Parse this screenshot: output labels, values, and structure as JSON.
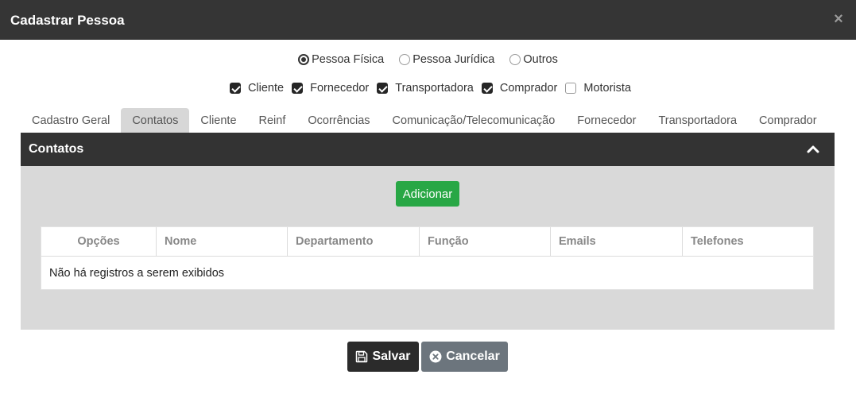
{
  "header": {
    "title": "Cadastrar Pessoa",
    "close_label": "×"
  },
  "person_type": {
    "options": [
      {
        "label": "Pessoa Física",
        "checked": true
      },
      {
        "label": "Pessoa Jurídica",
        "checked": false
      },
      {
        "label": "Outros",
        "checked": false
      }
    ]
  },
  "roles": {
    "options": [
      {
        "label": "Cliente",
        "checked": true
      },
      {
        "label": "Fornecedor",
        "checked": true
      },
      {
        "label": "Transportadora",
        "checked": true
      },
      {
        "label": "Comprador",
        "checked": true
      },
      {
        "label": "Motorista",
        "checked": false
      }
    ]
  },
  "tabs": [
    {
      "label": "Cadastro Geral",
      "active": false
    },
    {
      "label": "Contatos",
      "active": true
    },
    {
      "label": "Cliente",
      "active": false
    },
    {
      "label": "Reinf",
      "active": false
    },
    {
      "label": "Ocorrências",
      "active": false
    },
    {
      "label": "Comunicação/Telecomunicação",
      "active": false
    },
    {
      "label": "Fornecedor",
      "active": false
    },
    {
      "label": "Transportadora",
      "active": false
    },
    {
      "label": "Comprador",
      "active": false
    }
  ],
  "panel": {
    "title": "Contatos",
    "add_label": "Adicionar",
    "table": {
      "columns": [
        "Opções",
        "Nome",
        "Departamento",
        "Função",
        "Emails",
        "Telefones"
      ],
      "empty_text": "Não há registros a serem exibidos"
    }
  },
  "footer": {
    "save_label": "Salvar",
    "cancel_label": "Cancelar"
  },
  "colors": {
    "header_bg": "#353535",
    "panel_head_bg": "#333333",
    "panel_body_bg": "#d9d9d9",
    "add_button": "#28a745",
    "save_button": "#2b2b2b",
    "cancel_button": "#6c757d"
  },
  "icons": {
    "close": "close-icon",
    "collapse": "chevron-up-icon",
    "save": "floppy-disk-icon",
    "cancel": "circle-x-icon"
  }
}
